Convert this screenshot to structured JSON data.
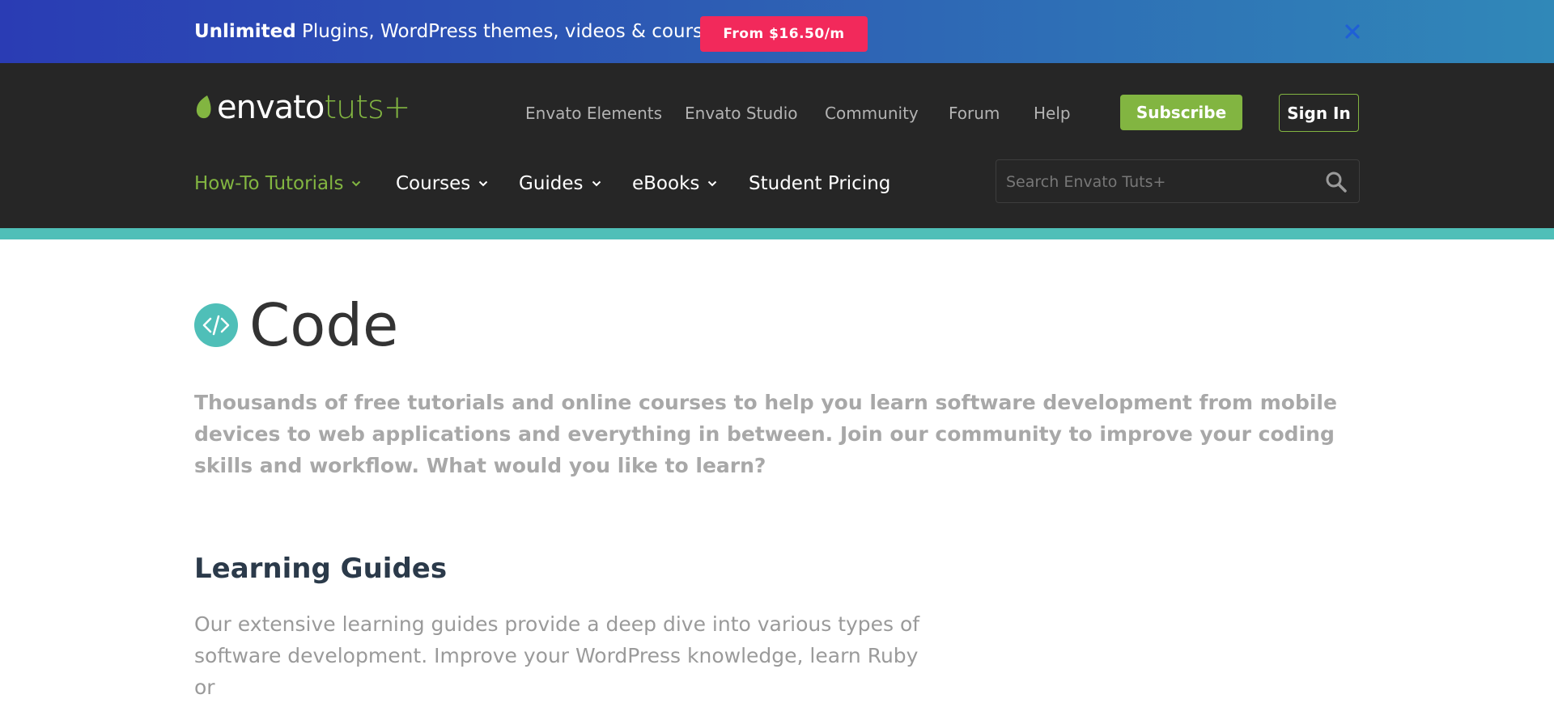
{
  "promo": {
    "bold": "Unlimited",
    "text": "Plugins, WordPress themes, videos & courses!",
    "button": "From $16.50/m",
    "close_icon": "close-icon"
  },
  "logo": {
    "envato": "envato",
    "tuts": "tuts+"
  },
  "top_nav": [
    "Envato Elements",
    "Envato Studio",
    "Community",
    "Forum",
    "Help"
  ],
  "actions": {
    "subscribe": "Subscribe",
    "sign_in": "Sign In"
  },
  "main_nav": [
    {
      "label": "How-To Tutorials",
      "dropdown": true,
      "active": true
    },
    {
      "label": "Courses",
      "dropdown": true,
      "active": false
    },
    {
      "label": "Guides",
      "dropdown": true,
      "active": false
    },
    {
      "label": "eBooks",
      "dropdown": true,
      "active": false
    },
    {
      "label": "Student Pricing",
      "dropdown": false,
      "active": false
    }
  ],
  "search": {
    "placeholder": "Search Envato Tuts+",
    "value": ""
  },
  "page": {
    "title": "Code",
    "intro": "Thousands of free tutorials and online courses to help you learn software development from mobile devices to web applications and everything in between. Join our community to improve your coding skills and workflow. What would you like to learn?",
    "learning_guides_title": "Learning Guides",
    "learning_guides_desc": "Our extensive learning guides provide a deep dive into various types of software development. Improve your WordPress knowledge, learn Ruby or"
  },
  "colors": {
    "accent_green": "#82b541",
    "promo_button": "#f2295b",
    "teal": "#4fbfb8",
    "header_bg": "#262626"
  }
}
